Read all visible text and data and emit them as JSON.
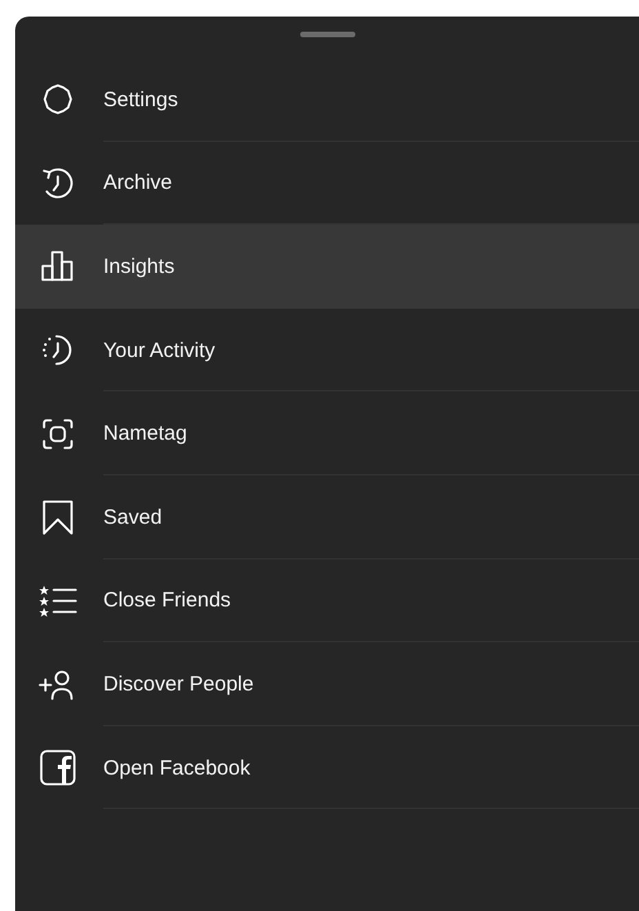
{
  "menu": {
    "items": [
      {
        "kind": "settings",
        "label": "Settings",
        "selected": false
      },
      {
        "kind": "archive",
        "label": "Archive",
        "selected": false
      },
      {
        "kind": "insights",
        "label": "Insights",
        "selected": true
      },
      {
        "kind": "activity",
        "label": "Your Activity",
        "selected": false
      },
      {
        "kind": "nametag",
        "label": "Nametag",
        "selected": false
      },
      {
        "kind": "saved",
        "label": "Saved",
        "selected": false
      },
      {
        "kind": "close-friends",
        "label": "Close Friends",
        "selected": false
      },
      {
        "kind": "discover",
        "label": "Discover People",
        "selected": false
      },
      {
        "kind": "facebook",
        "label": "Open Facebook",
        "selected": false
      }
    ]
  }
}
